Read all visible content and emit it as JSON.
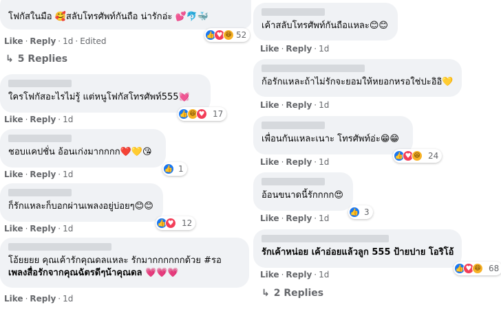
{
  "actions": {
    "like": "Like",
    "reply": "Reply",
    "dot": "·",
    "age": "1d",
    "edited": "Edited"
  },
  "left": [
    {
      "text": "โฟกัสในมือ 🥰สลับโทรศัพท์กันถือ น่ารักอ่ะ 💕🐬🐳",
      "reactions": [
        "like",
        "love",
        "haha"
      ],
      "count": "52",
      "edited": true,
      "replies": "5 Replies"
    },
    {
      "text": "ใครโฟกัสอะไรไม่รู้ แต่หนูโฟกัสโทรศัพท์555💓",
      "reactions": [
        "like",
        "haha",
        "love"
      ],
      "count": "17"
    },
    {
      "text": "ชอบแคปชั่น อ้อนเก่งมากกกก❤️💛😘",
      "reactions": [
        "like"
      ],
      "count": "1"
    },
    {
      "text": "ก็รักแหละก็บอกผ่านเพลงอยู่บ่อยๆ😊😊",
      "reactions": [
        "like",
        "love"
      ],
      "count": "12"
    },
    {
      "text_line1": "โอ้ยยยย คุณเค้ารักคุณดลแหละ รักมากกกกกกด้วย #รอ",
      "text_line2": "เพลงสื่อรักจากคุณฉัตรดีๆน้าคุณดล 💗💗💗"
    }
  ],
  "right": [
    {
      "text": "เค้าสลับโทรศัพท์กันถือแหละ😊😊"
    },
    {
      "text": "ก้อรักแหละถ้าไม่รักจะยอมให้หยอกหรอใช่ปะอิอิ💛"
    },
    {
      "text": "เพื่อนกันแหละเนาะ โทรศัพท์อ่ะ😁😁",
      "reactions": [
        "like",
        "love",
        "haha"
      ],
      "count": "24"
    },
    {
      "text": "อ้อนขนาดนี้รักกกก😍",
      "reactions": [
        "like"
      ],
      "count": "3"
    },
    {
      "text": "รักเค้าหน่อย เค้าอ่อยแล้วลูก 555 ป้ายปาย โอริโอ้",
      "reactions": [
        "like",
        "love",
        "haha"
      ],
      "count": "68",
      "replies": "2 Replies"
    }
  ]
}
